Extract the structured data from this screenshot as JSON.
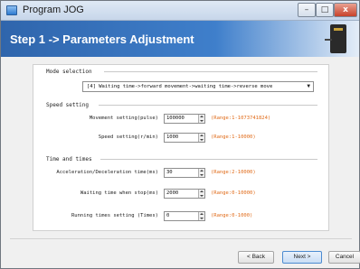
{
  "window": {
    "title": "Program JOG",
    "controls": {
      "minimize": "–",
      "maximize": "□",
      "close": "x"
    }
  },
  "banner": {
    "step_title": "Step 1 -> Parameters Adjustment"
  },
  "mode_selection": {
    "label": "Mode selection",
    "selected": "[4] Waiting time->forward movement->waiting time->reverse move"
  },
  "speed_setting": {
    "label": "Speed setting",
    "rows": [
      {
        "label": "Movement setting(pulse)",
        "value": "100000",
        "range": "(Range:1-1073741824)"
      },
      {
        "label": "Speed setting(r/min)",
        "value": "1000",
        "range": "(Range:1-10000)"
      }
    ]
  },
  "time_and_times": {
    "label": "Time and times",
    "rows": [
      {
        "label": "Acceleration/Deceleration time(ms)",
        "value": "30",
        "range": "(Range:2-10000)"
      },
      {
        "label": "Waiting time when stop(ms)",
        "value": "2000",
        "range": "(Range:0-10000)"
      },
      {
        "label": "Running times setting (Times)",
        "value": "0",
        "range": "(Range:0-1000)"
      }
    ]
  },
  "footer": {
    "back": "< Back",
    "next": "Next >",
    "cancel": "Cancel"
  },
  "colors": {
    "banner": "#3f7fcb",
    "range_text": "#e06a17"
  }
}
